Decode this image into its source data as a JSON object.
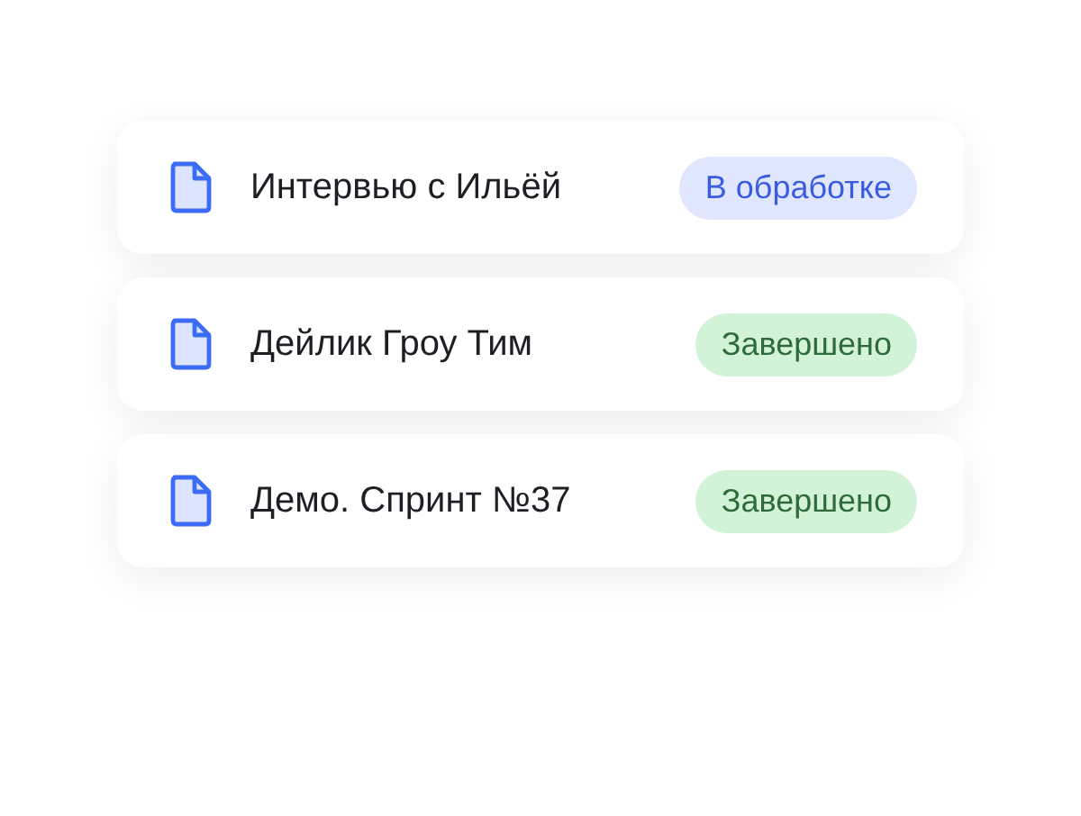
{
  "items": [
    {
      "title": "Интервью с Ильёй",
      "status": {
        "label": "В обработке",
        "kind": "processing"
      }
    },
    {
      "title": "Дейлик Гроу Тим",
      "status": {
        "label": "Завершено",
        "kind": "done"
      }
    },
    {
      "title": "Демо. Спринт №37",
      "status": {
        "label": "Завершено",
        "kind": "done"
      }
    }
  ]
}
